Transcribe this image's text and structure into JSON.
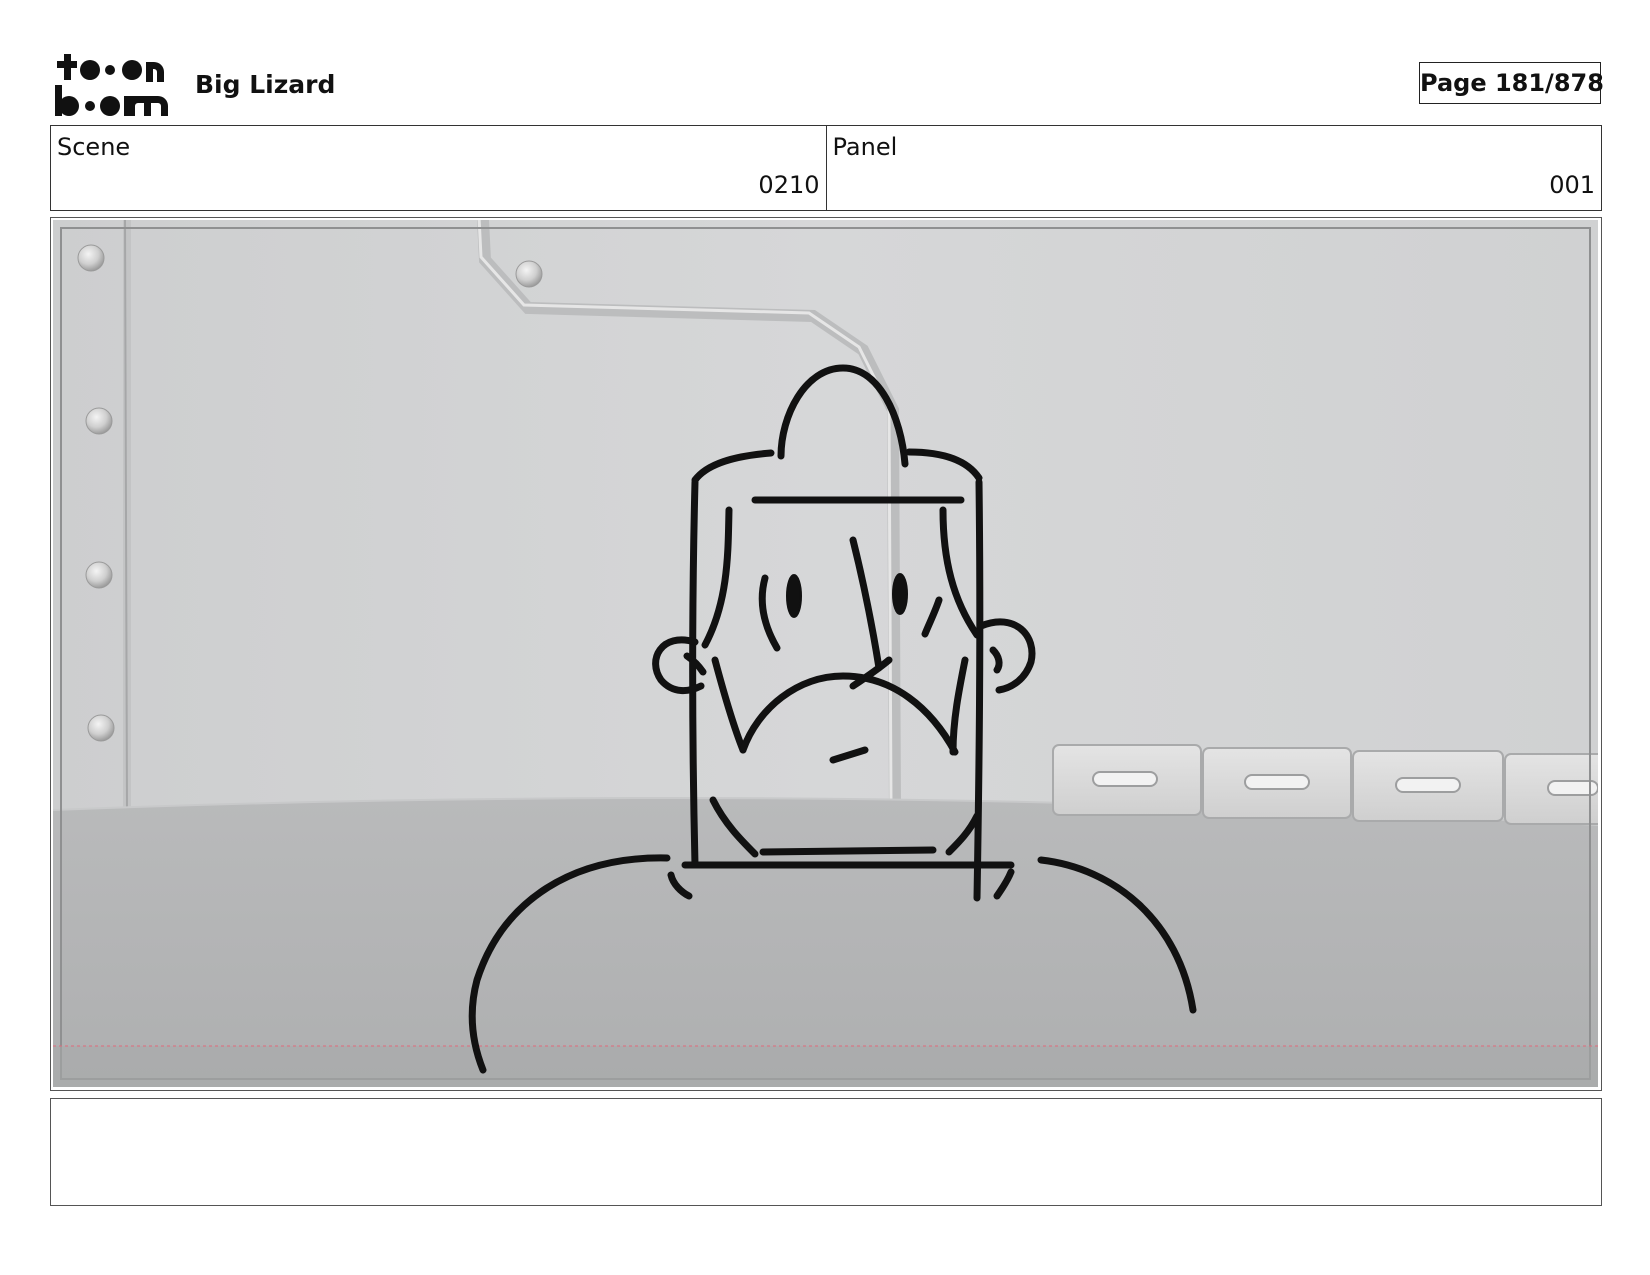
{
  "header": {
    "logo_top": "to●n",
    "logo_bottom": "b●●m",
    "project_title": "Big Lizard",
    "page_counter": "Page 181/878"
  },
  "info": {
    "scene_label": "Scene",
    "scene_value": "0210",
    "panel_label": "Panel",
    "panel_value": "001"
  },
  "panel": {
    "image_icon": "storyboard-sketch-image",
    "line_color": "#111111",
    "wall_color": "#d2d3d4",
    "floor_color": "#b4b5b6",
    "safe_area_color": "#e06a7a"
  },
  "notes": {
    "text": ""
  }
}
